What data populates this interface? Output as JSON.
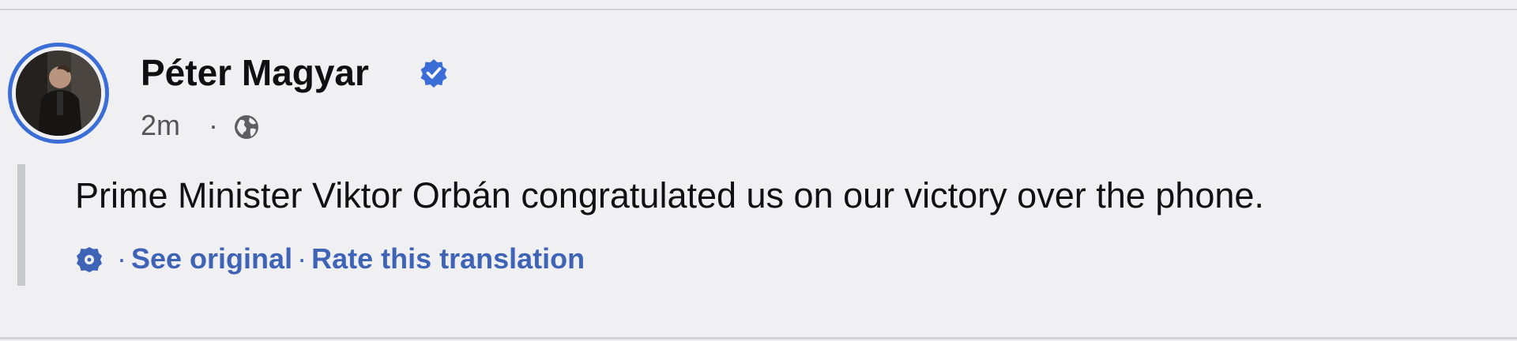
{
  "post": {
    "author_name": "Péter Magyar",
    "verified_icon": "verified-badge-icon",
    "timestamp": "2m",
    "separator": "·",
    "audience_icon": "globe-icon",
    "text": "Prime Minister Viktor Orbán congratulated us on our victory over the phone."
  },
  "translation": {
    "icon": "gear-icon",
    "separator": "·",
    "see_original_label": "See original",
    "rate_label": "Rate this translation"
  },
  "colors": {
    "accent": "#3b6dd6",
    "link": "#3f64b6",
    "background": "#f0f0f2"
  }
}
